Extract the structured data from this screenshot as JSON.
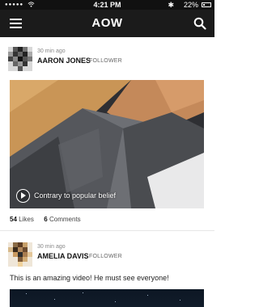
{
  "status_bar": {
    "signal": "●●●●●",
    "time": "4:21 PM",
    "battery_text": "22%",
    "battery_level": 0.22
  },
  "nav": {
    "title": "AOW"
  },
  "posts": [
    {
      "time_ago": "30 min ago",
      "author": "AARON JONES",
      "relation": "FOLLOWER",
      "video_title": "Contrary to popular belief",
      "likes_count": "54",
      "likes_label": "Likes",
      "comments_count": "6",
      "comments_label": "Comments"
    },
    {
      "time_ago": "30 min ago",
      "author": "AMELIA DAVIS",
      "relation": "FOLLOWER",
      "text": "This is an amazing video! He must see everyone!"
    }
  ],
  "colors": {
    "status_bar": "#111111",
    "nav_bar": "#1b1b1b",
    "divider": "#e6e6e6"
  },
  "icons": {
    "menu": "hamburger-menu-icon",
    "search": "search-icon",
    "play": "play-icon",
    "wifi": "wifi-icon",
    "bluetooth": "bluetooth-icon",
    "battery": "battery-icon"
  }
}
